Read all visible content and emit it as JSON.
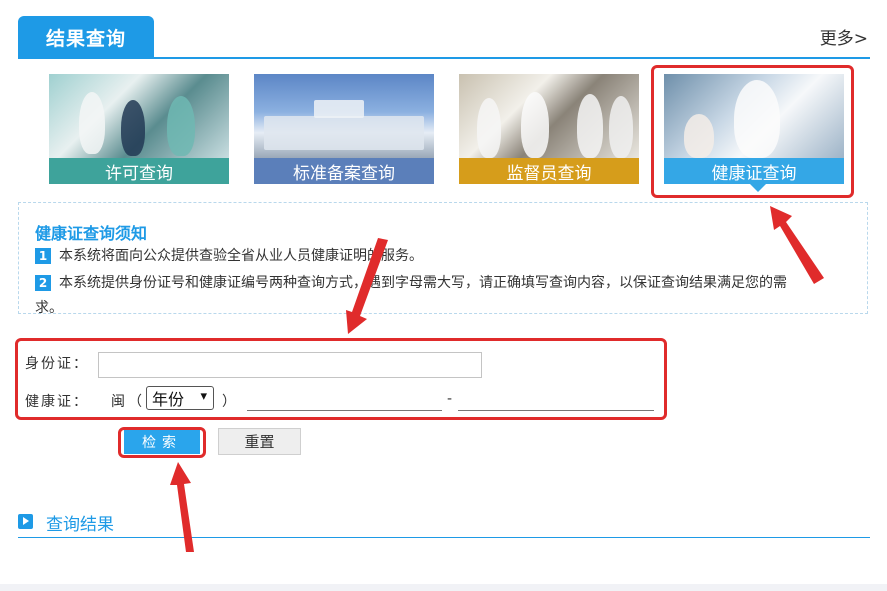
{
  "header": {
    "tab_title": "结果查询",
    "more_label": "更多>"
  },
  "categories": [
    {
      "label": "许可查询",
      "color": "#3ea39b"
    },
    {
      "label": "标准备案查询",
      "color": "#5b7fba"
    },
    {
      "label": "监督员查询",
      "color": "#d69d1b"
    },
    {
      "label": "健康证查询",
      "color": "#34a7e6"
    }
  ],
  "notice": {
    "title": "健康证查询须知",
    "items": [
      {
        "num": "1",
        "text": "本系统将面向公众提供查验全省从业人员健康证明的服务。"
      },
      {
        "num": "2",
        "text": "本系统提供身份证号和健康证编号两种查询方式，遇到字母需大写，请正确填写查询内容，以保证查询结果满足您的需",
        "wrap": "求。"
      }
    ]
  },
  "form": {
    "id_label": "身份证：",
    "id_value": "",
    "health_label": "健康证：",
    "prefix": "闽",
    "open_paren": "（",
    "year_value": "年份",
    "close_paren": "）",
    "dash": "-"
  },
  "buttons": {
    "search": "检索",
    "reset": "重置"
  },
  "result": {
    "title": "查询结果"
  },
  "colors": {
    "primary": "#1e9ae6",
    "highlight": "#e02b2b"
  }
}
